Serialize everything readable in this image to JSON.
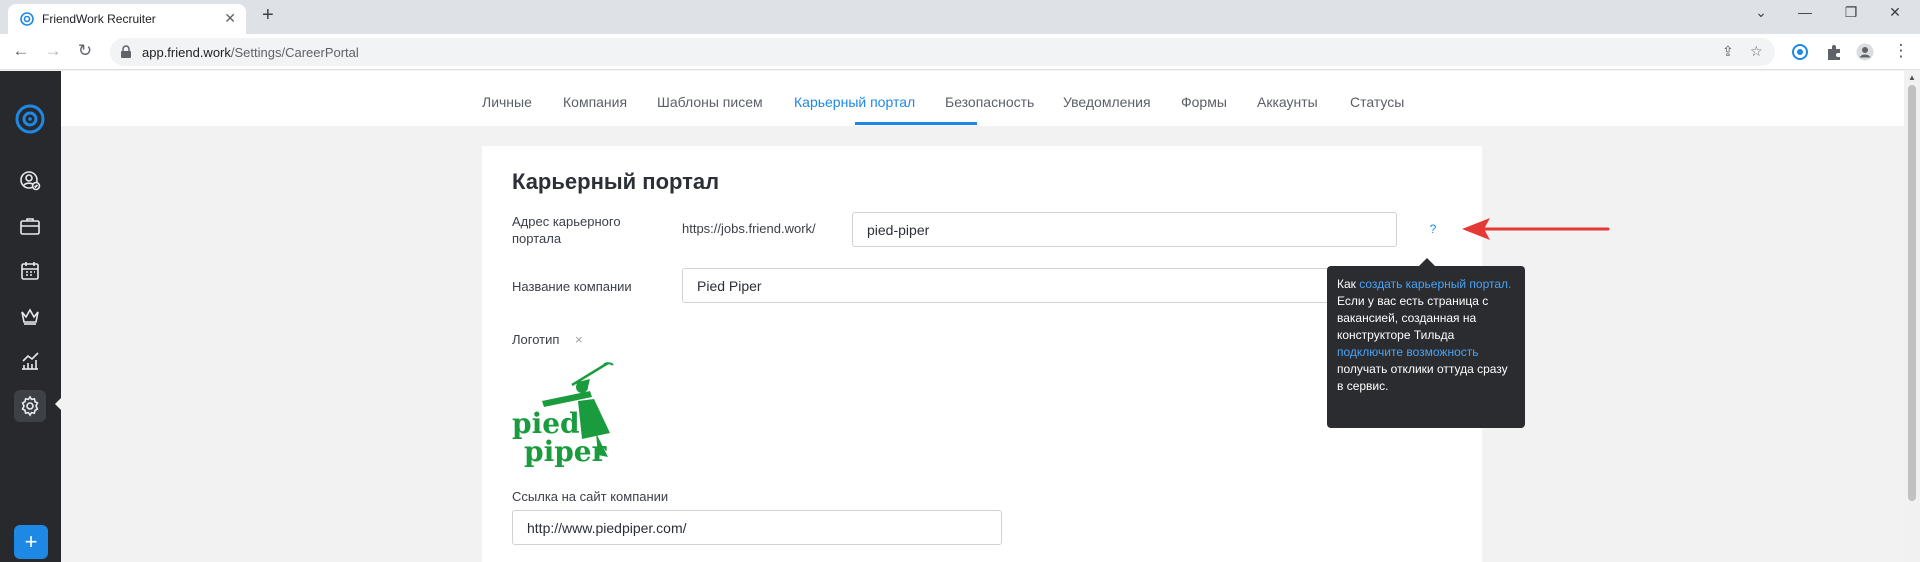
{
  "browser": {
    "tab_title": "FriendWork Recruiter",
    "tab_close": "✕",
    "new_tab": "+",
    "url_host": "app.friend.work",
    "url_path": "/Settings/CareerPortal",
    "window_controls": [
      "⌄",
      "—",
      "❐",
      "✕"
    ]
  },
  "settings_tabs": [
    "Личные",
    "Компания",
    "Шаблоны писем",
    "Карьерный портал",
    "Безопасность",
    "Уведомления",
    "Формы",
    "Аккаунты",
    "Статусы"
  ],
  "active_tab_index": 3,
  "card": {
    "title": "Карьерный портал",
    "portal_address_label": "Адрес карьерного портала",
    "portal_prefix": "https://jobs.friend.work/",
    "portal_slug": "pied-piper",
    "help_symbol": "?",
    "company_name_label": "Название компании",
    "company_name": "Pied Piper",
    "logo_label": "Логотип",
    "logo_remove": "×",
    "logo_text_top": "pied",
    "logo_text_bottom": "piper",
    "website_label": "Ссылка на сайт компании",
    "website": "http://www.piedpiper.com/"
  },
  "tooltip": {
    "t1": "Как ",
    "link1": "создать карьерный портал.",
    "t2": " Если у вас есть страница с вакансией, созданная на конструкторе Тильда ",
    "link2": "подключите возможность",
    "t3": " получать отклики оттуда сразу в сервис."
  },
  "sidebar": {
    "add_label": "+"
  },
  "colors": {
    "accent": "#1e88e5",
    "sidebar_bg": "#27292d",
    "logo_green": "#1a9c3e",
    "annotation_red": "#e53935"
  }
}
